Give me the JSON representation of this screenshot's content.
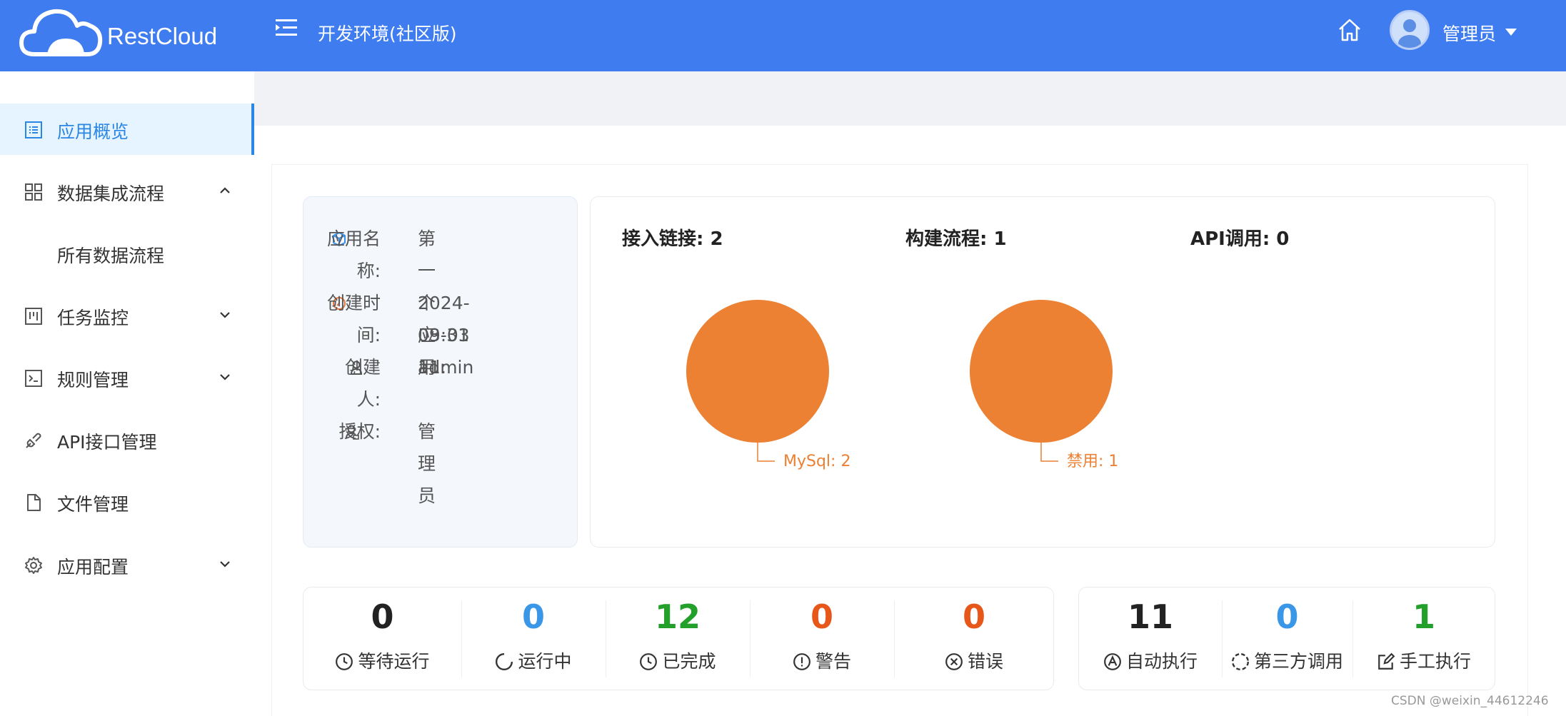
{
  "header": {
    "brand": "RestCloud",
    "env_title": "开发环境(社区版)",
    "user_name": "管理员",
    "bg_color": "#3e7cef"
  },
  "sidebar": {
    "items": [
      {
        "label": "应用概览",
        "icon": "overview-icon",
        "active": true
      },
      {
        "label": "数据集成流程",
        "icon": "grid-icon",
        "expanded": true
      },
      {
        "label": "所有数据流程",
        "sub": true
      },
      {
        "label": "任务监控",
        "icon": "monitor-icon",
        "expanded": false
      },
      {
        "label": "规则管理",
        "icon": "terminal-icon",
        "expanded": false
      },
      {
        "label": "API接口管理",
        "icon": "api-icon"
      },
      {
        "label": "文件管理",
        "icon": "file-icon"
      },
      {
        "label": "应用配置",
        "icon": "gear-icon",
        "expanded": false
      }
    ]
  },
  "app_info": {
    "name_label_1": "应用名",
    "name_label_2": "称:",
    "name_value": "第一个应用",
    "created_label_1": "创建时",
    "created_label_2": "间:",
    "created_value_1": "2024-03-03 11:",
    "created_value_2": "09:31",
    "creator_label_1": "创建",
    "creator_label_2": "人:",
    "creator_value": "admin",
    "auth_label": "授权:",
    "auth_value": "管理员"
  },
  "stats": {
    "links": "接入链接: 2",
    "flows": "构建流程: 1",
    "api_calls": "API调用: 0"
  },
  "chart_data": [
    {
      "type": "pie",
      "categories": [
        "MySql"
      ],
      "values": [
        2
      ],
      "labels": [
        "MySql: 2"
      ],
      "color": "#ec8033"
    },
    {
      "type": "pie",
      "categories": [
        "禁用"
      ],
      "values": [
        1
      ],
      "labels": [
        "禁用: 1"
      ],
      "color": "#ec8033"
    }
  ],
  "task_stats": [
    {
      "value": "0",
      "label": "等待运行",
      "color": "#222222",
      "icon": "clock-icon"
    },
    {
      "value": "0",
      "label": "运行中",
      "color": "#3a96e6",
      "icon": "loading-icon"
    },
    {
      "value": "12",
      "label": "已完成",
      "color": "#22a02a",
      "icon": "clock-icon"
    },
    {
      "value": "0",
      "label": "警告",
      "color": "#e8571a",
      "icon": "warning-icon"
    },
    {
      "value": "0",
      "label": "错误",
      "color": "#e8571a",
      "icon": "error-icon"
    }
  ],
  "exec_stats": [
    {
      "value": "11",
      "label": "自动执行",
      "color": "#222222",
      "icon": "auto-icon"
    },
    {
      "value": "0",
      "label": "第三方调用",
      "color": "#3a96e6",
      "icon": "third-party-icon"
    },
    {
      "value": "1",
      "label": "手工执行",
      "color": "#22a02a",
      "icon": "edit-icon"
    }
  ],
  "watermark": "CSDN @weixin_44612246"
}
